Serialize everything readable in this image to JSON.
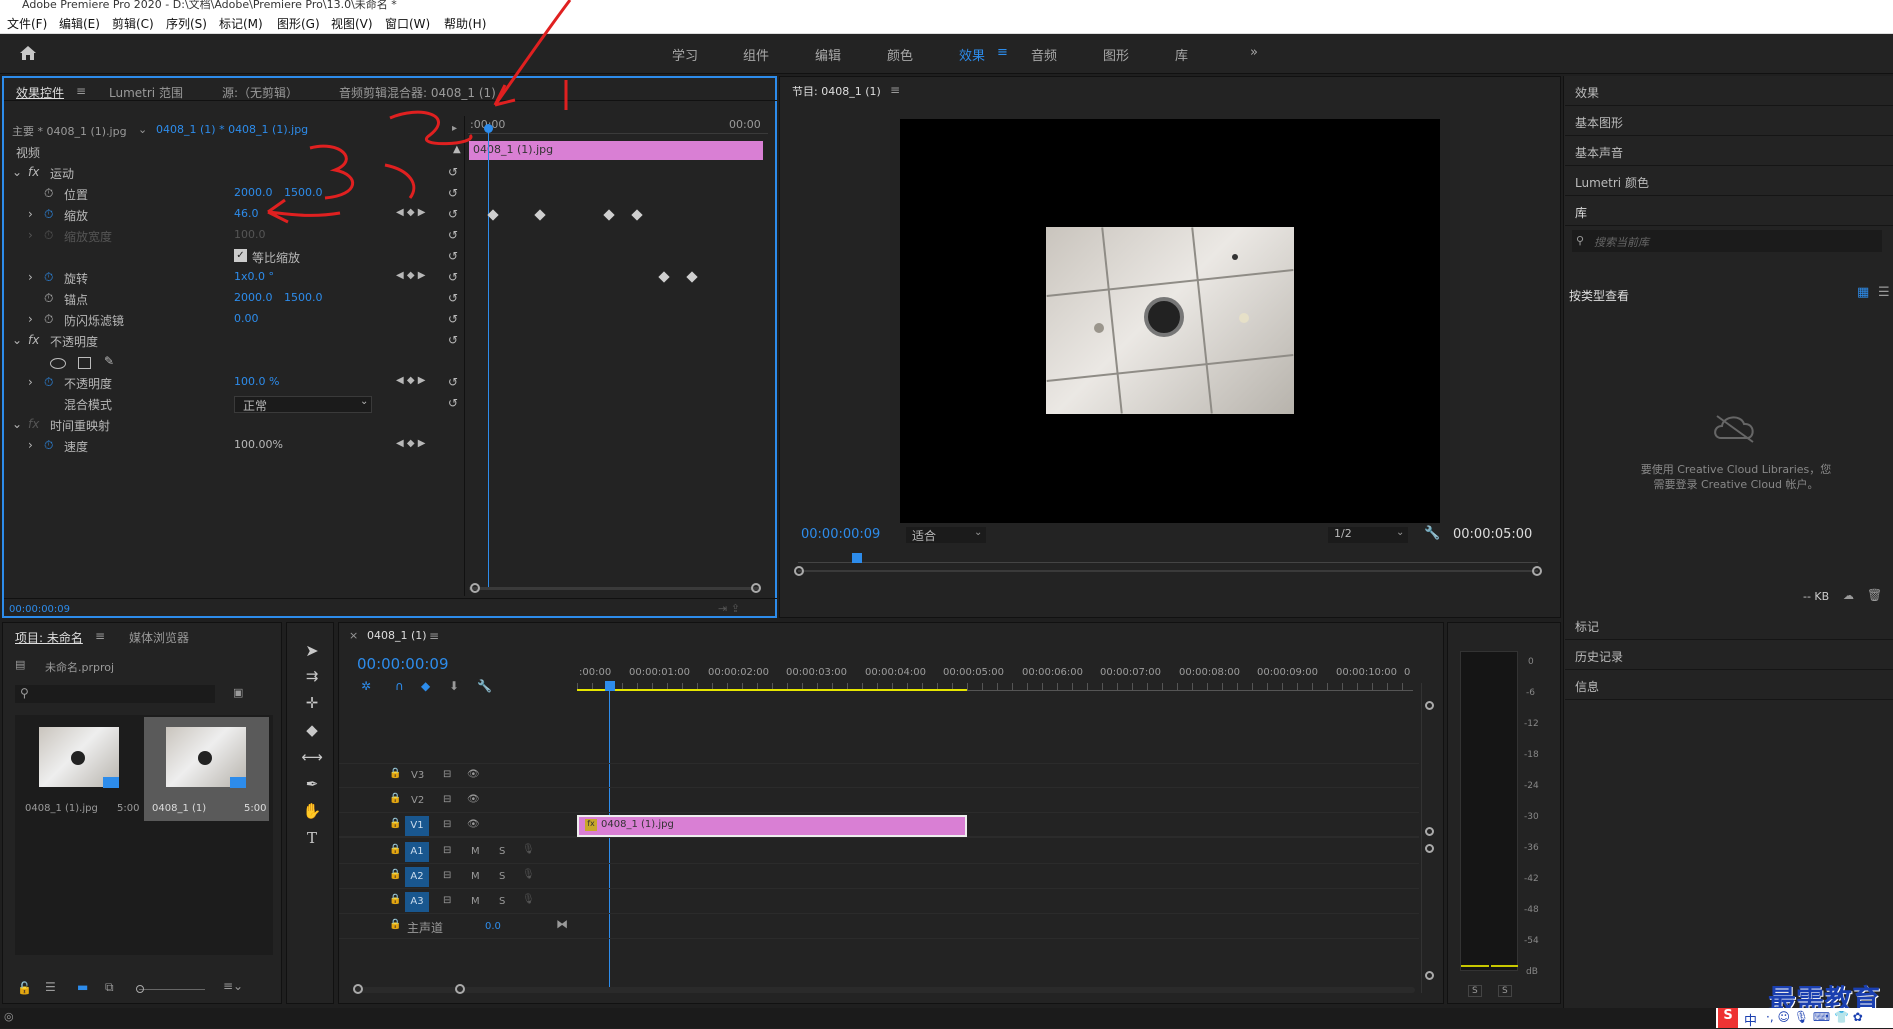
{
  "window": {
    "title": "Adobe Premiere Pro 2020 - D:\\文档\\Adobe\\Premiere Pro\\13.0\\未命名 *"
  },
  "menu": [
    "文件(F)",
    "编辑(E)",
    "剪辑(C)",
    "序列(S)",
    "标记(M)",
    "图形(G)",
    "视图(V)",
    "窗口(W)",
    "帮助(H)"
  ],
  "workspaces": [
    "学习",
    "组件",
    "编辑",
    "颜色",
    "效果",
    "音频",
    "图形",
    "库"
  ],
  "workspace_more": "»",
  "effect_controls": {
    "tabs": [
      "效果控件",
      "Lumetri 范围",
      "源:（无剪辑）",
      "音频剪辑混合器: 0408_1 (1)"
    ],
    "menu_glyph": "≡",
    "source_label": "主要 * 0408_1 (1).jpg",
    "clip_label": "0408_1 (1) * 0408_1 (1).jpg",
    "ruler_start": ":00:00",
    "ruler_end": "00:00",
    "clip_bar": "0408_1 (1).jpg",
    "video_header": "视频",
    "motion": "运动",
    "position": {
      "label": "位置",
      "x": "2000.0",
      "y": "1500.0"
    },
    "scale": {
      "label": "缩放",
      "value": "46.0"
    },
    "scale_width": {
      "label": "缩放宽度",
      "value": "100.0"
    },
    "uniform": "等比缩放",
    "rotation": {
      "label": "旋转",
      "value": "1x0.0 °"
    },
    "anchor": {
      "label": "锚点",
      "x": "2000.0",
      "y": "1500.0"
    },
    "flicker": {
      "label": "防闪烁滤镜",
      "value": "0.00"
    },
    "opacity": "不透明度",
    "opacity_value": {
      "label": "不透明度",
      "value": "100.0 %"
    },
    "blend": {
      "label": "混合模式",
      "value": "正常"
    },
    "time_remap": "时间重映射",
    "speed": {
      "label": "速度",
      "value": "100.00%"
    },
    "timecode": "00:00:00:09"
  },
  "program": {
    "title": "节目: 0408_1 (1)",
    "timecode": "00:00:00:09",
    "fit": "适合",
    "resolution": "1/2",
    "duration": "00:00:05:00",
    "playhead_fraction": 0.08
  },
  "right_panels": [
    "效果",
    "基本图形",
    "基本声音",
    "Lumetri 颜色"
  ],
  "library": {
    "title": "库",
    "search_placeholder": "搜索当前库",
    "view": "按类型查看",
    "message": "要使用 Creative Cloud Libraries，您需要登录 Creative Cloud 帐户。",
    "kb": "-- KB"
  },
  "right_bottom": [
    "标记",
    "历史记录",
    "信息"
  ],
  "project": {
    "tabs": [
      "项目: 未命名",
      "媒体浏览器"
    ],
    "file": "未命名.prproj",
    "items": [
      {
        "name": "0408_1 (1).jpg",
        "dur": "5:00"
      },
      {
        "name": "0408_1 (1)",
        "dur": "5:00"
      }
    ]
  },
  "timeline": {
    "tab": "0408_1 (1)",
    "timecode": "00:00:00:09",
    "ruler": [
      ":00:00",
      "00:00:01:00",
      "00:00:02:00",
      "00:00:03:00",
      "00:00:04:00",
      "00:00:05:00",
      "00:00:06:00",
      "00:00:07:00",
      "00:00:08:00",
      "00:00:09:00",
      "00:00:10:00",
      "0"
    ],
    "video_tracks": [
      "V3",
      "V2",
      "V1"
    ],
    "audio_tracks": [
      "A1",
      "A2",
      "A3"
    ],
    "track_buttons": {
      "m": "M",
      "s": "S"
    },
    "master": {
      "label": "主声道",
      "value": "0.0"
    },
    "clip": "0408_1 (1).jpg",
    "fx": "fx"
  },
  "meter": {
    "scale": [
      "0",
      "-6",
      "-12",
      "-18",
      "-24",
      "-30",
      "-36",
      "-42",
      "-48",
      "-54",
      "dB"
    ],
    "solo": [
      "S",
      "S"
    ]
  },
  "watermark": "最需教育",
  "ime": "中"
}
